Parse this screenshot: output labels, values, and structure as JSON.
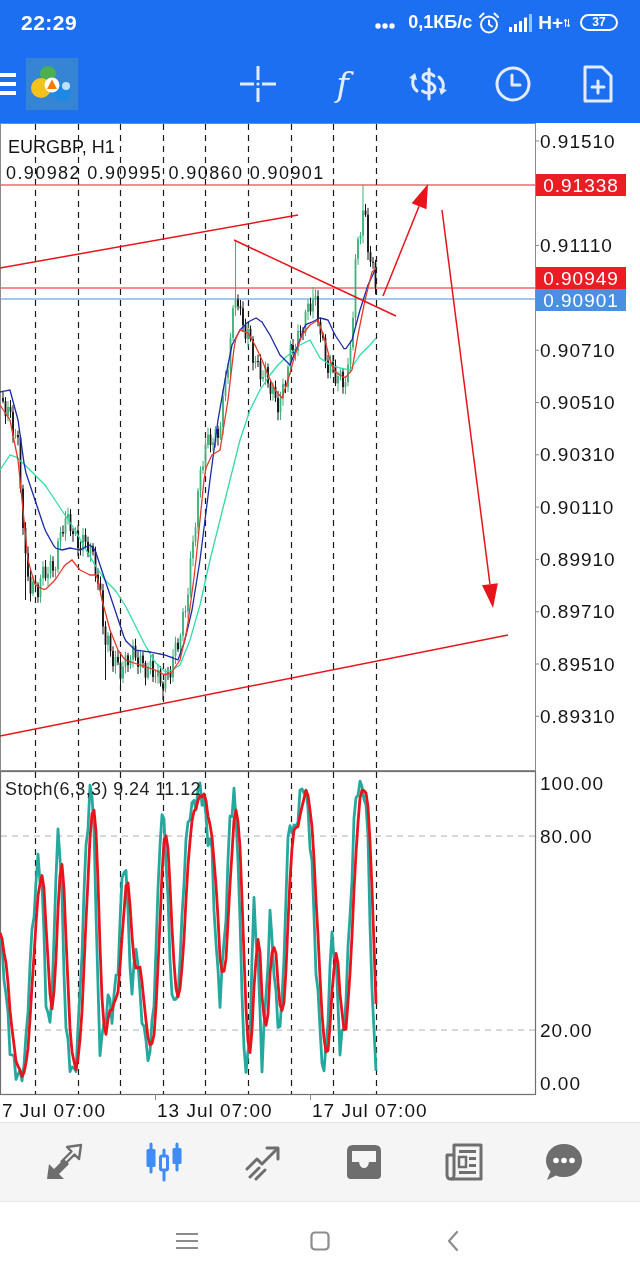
{
  "status_bar": {
    "time": "22:29",
    "network_speed": "0,1КБ/с",
    "network_type": "H+",
    "battery": "37"
  },
  "toolbar": {
    "function_glyph": "f"
  },
  "chart": {
    "symbol": "EURGBP, H1",
    "ohlc": "0.90982 0.90995 0.90860 0.90901",
    "price_axis": [
      "0.91510",
      "0.91110",
      "0.90710",
      "0.90510",
      "0.90310",
      "0.90110",
      "0.89910",
      "0.89710",
      "0.89510",
      "0.89310"
    ],
    "price_markers": [
      {
        "price": "0.91338",
        "color": "#ea1c24"
      },
      {
        "price": "0.90949",
        "color": "#ea1c24"
      },
      {
        "price": "0.90901",
        "color": "#4a90e2"
      }
    ]
  },
  "indicator": {
    "label": "Stoch(6,3,3) 9.24 11.12",
    "levels": [
      "100.00",
      "80.00",
      "20.00",
      "0.00"
    ]
  },
  "time_axis": [
    "7 Jul 07:00",
    "13 Jul 07:00",
    "17 Jul 07:00"
  ],
  "bottom_nav": [
    {
      "selected": false
    },
    {
      "selected": true
    },
    {
      "selected": false
    },
    {
      "selected": false
    },
    {
      "selected": false
    },
    {
      "selected": false
    }
  ]
}
